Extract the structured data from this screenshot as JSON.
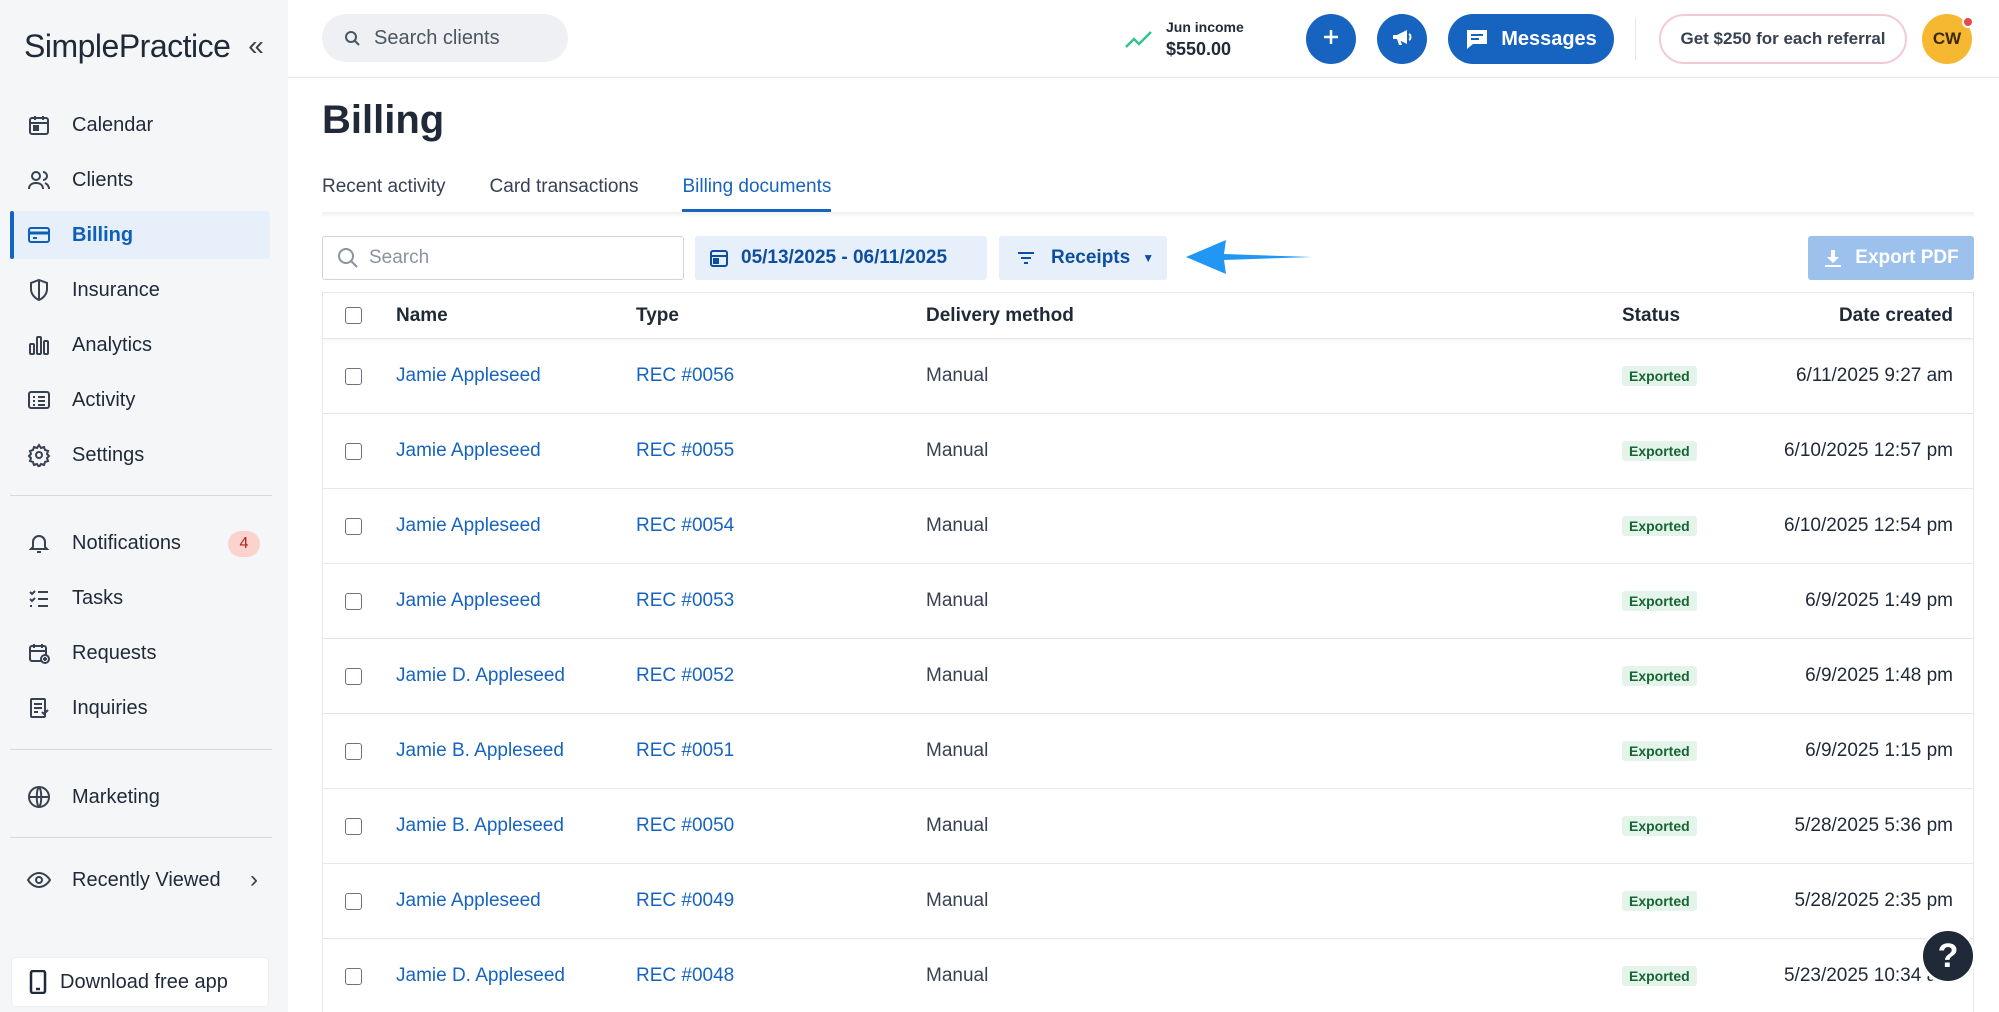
{
  "brand": {
    "logo_text": "SimplePractice"
  },
  "sidebar": {
    "items": [
      {
        "label": "Calendar",
        "icon": "calendar-icon"
      },
      {
        "label": "Clients",
        "icon": "users-icon"
      },
      {
        "label": "Billing",
        "icon": "credit-card-icon",
        "active": true
      },
      {
        "label": "Insurance",
        "icon": "shield-icon"
      },
      {
        "label": "Analytics",
        "icon": "bar-chart-icon"
      },
      {
        "label": "Activity",
        "icon": "list-icon"
      },
      {
        "label": "Settings",
        "icon": "gear-icon"
      }
    ],
    "secondary": [
      {
        "label": "Notifications",
        "icon": "bell-icon",
        "badge": "4"
      },
      {
        "label": "Tasks",
        "icon": "checklist-icon"
      },
      {
        "label": "Requests",
        "icon": "calendar-plus-icon"
      },
      {
        "label": "Inquiries",
        "icon": "document-list-icon"
      }
    ],
    "marketing": {
      "label": "Marketing",
      "icon": "globe-icon"
    },
    "recently_viewed": {
      "label": "Recently Viewed",
      "icon": "eye-icon"
    },
    "download_app": {
      "label": "Download free app",
      "icon": "phone-icon"
    }
  },
  "topbar": {
    "search_placeholder": "Search clients",
    "income_label": "Jun income",
    "income_value": "$550.00",
    "messages_label": "Messages",
    "referral_label": "Get $250 for each referral",
    "avatar_initials": "CW"
  },
  "page": {
    "title": "Billing",
    "tabs": [
      {
        "label": "Recent activity"
      },
      {
        "label": "Card transactions"
      },
      {
        "label": "Billing documents",
        "active": true
      }
    ]
  },
  "toolbar": {
    "search_placeholder": "Search",
    "date_range": "05/13/2025 - 06/11/2025",
    "filter_label": "Receipts",
    "export_label": "Export PDF"
  },
  "table": {
    "columns": {
      "name": "Name",
      "type": "Type",
      "delivery": "Delivery method",
      "status": "Status",
      "date": "Date created"
    },
    "rows": [
      {
        "name": "Jamie Appleseed",
        "type": "REC #0056",
        "delivery": "Manual",
        "status": "Exported",
        "date": "6/11/2025 9:27 am"
      },
      {
        "name": "Jamie Appleseed",
        "type": "REC #0055",
        "delivery": "Manual",
        "status": "Exported",
        "date": "6/10/2025 12:57 pm"
      },
      {
        "name": "Jamie Appleseed",
        "type": "REC #0054",
        "delivery": "Manual",
        "status": "Exported",
        "date": "6/10/2025 12:54 pm"
      },
      {
        "name": "Jamie Appleseed",
        "type": "REC #0053",
        "delivery": "Manual",
        "status": "Exported",
        "date": "6/9/2025 1:49 pm"
      },
      {
        "name": "Jamie D. Appleseed",
        "type": "REC #0052",
        "delivery": "Manual",
        "status": "Exported",
        "date": "6/9/2025 1:48 pm"
      },
      {
        "name": "Jamie B. Appleseed",
        "type": "REC #0051",
        "delivery": "Manual",
        "status": "Exported",
        "date": "6/9/2025 1:15 pm"
      },
      {
        "name": "Jamie B. Appleseed",
        "type": "REC #0050",
        "delivery": "Manual",
        "status": "Exported",
        "date": "5/28/2025 5:36 pm"
      },
      {
        "name": "Jamie Appleseed",
        "type": "REC #0049",
        "delivery": "Manual",
        "status": "Exported",
        "date": "5/28/2025 2:35 pm"
      },
      {
        "name": "Jamie D. Appleseed",
        "type": "REC #0048",
        "delivery": "Manual",
        "status": "Exported",
        "date": "5/23/2025 10:34 am"
      }
    ]
  },
  "help": {
    "label": "?"
  },
  "colors": {
    "accent": "#1664c0",
    "sidebar_bg": "#f5f6f8",
    "active_bg": "#e6effa",
    "badge_bg": "#e5f4ea",
    "arrow": "#2196f3"
  }
}
